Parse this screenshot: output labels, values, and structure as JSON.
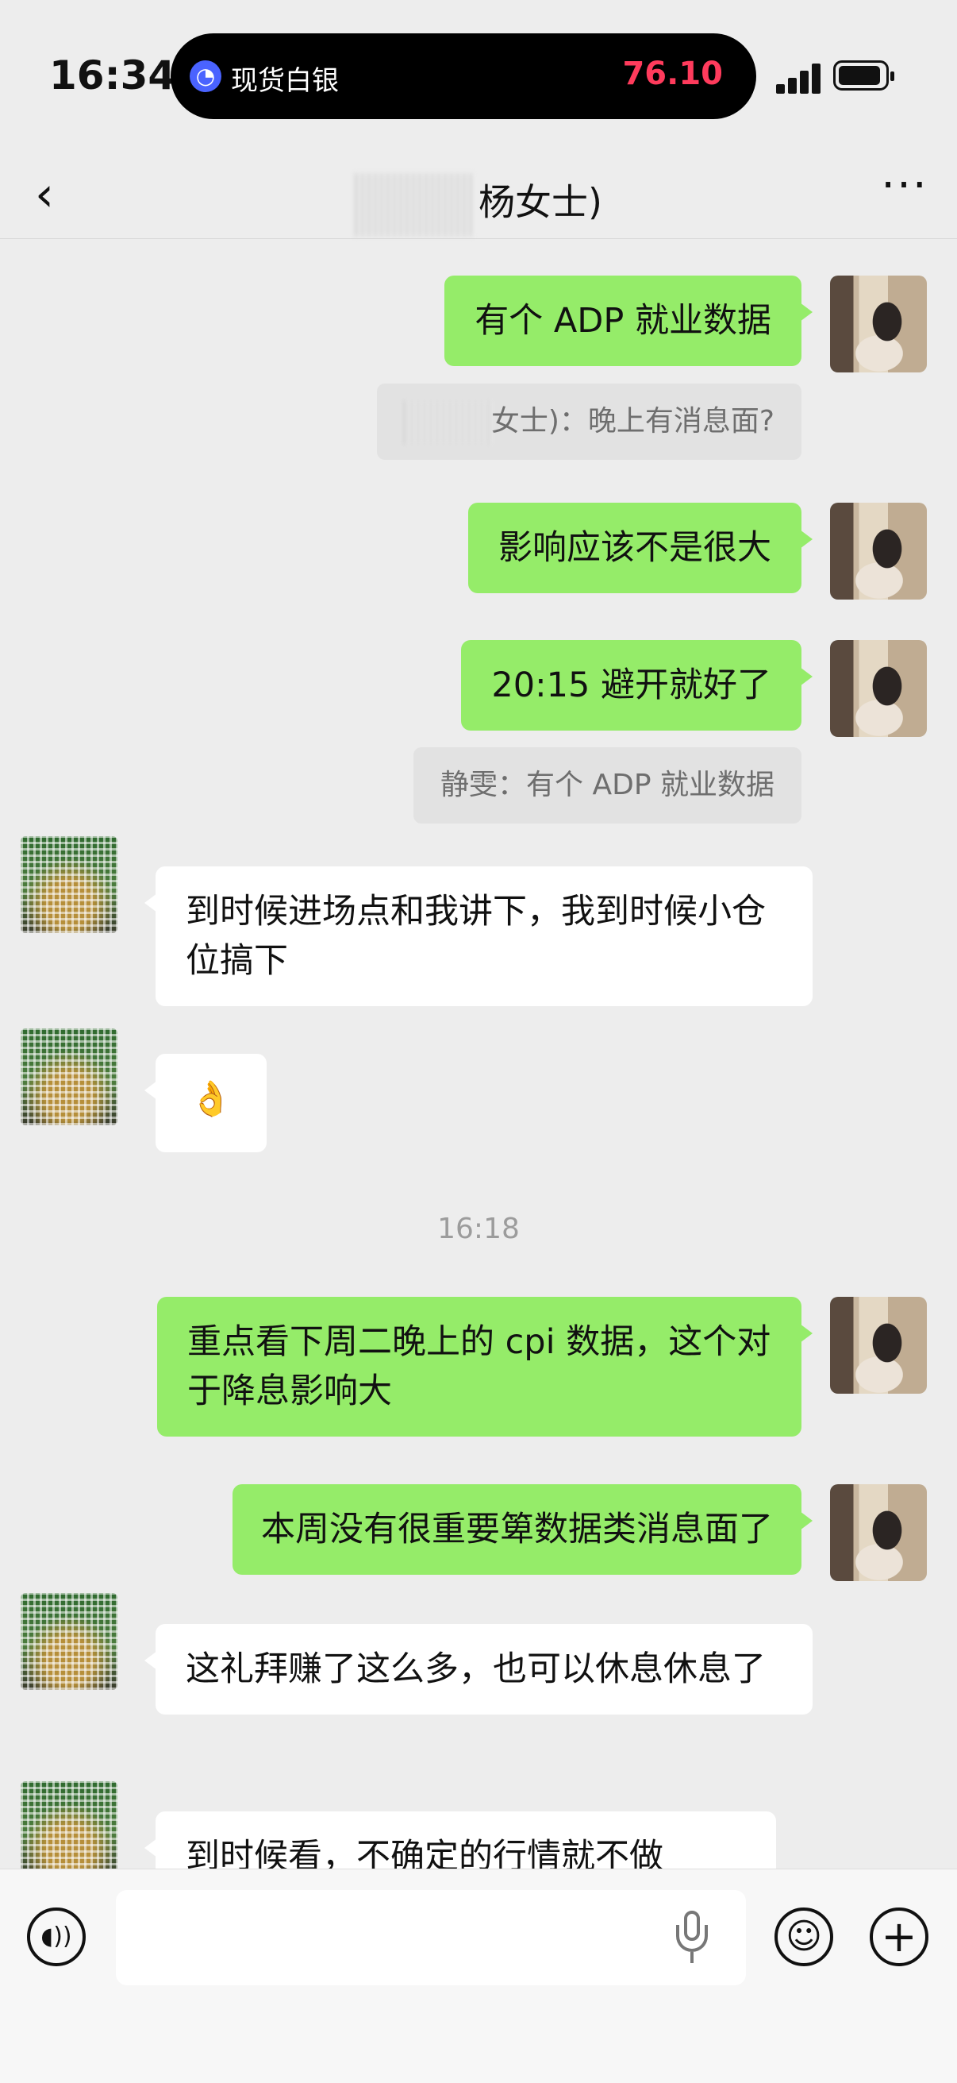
{
  "status_bar": {
    "time": "16:34",
    "live_activity_app": "现货白银",
    "live_activity_price": "76.10"
  },
  "header": {
    "title": "杨女士)",
    "back_icon": "chevron-left-icon",
    "more_icon": "more-dots-icon"
  },
  "messages": [
    {
      "side": "me",
      "text": "有个 ADP 就业数据"
    },
    {
      "type": "quote",
      "text": "女士)：晚上有消息面?"
    },
    {
      "side": "me",
      "text": "影响应该不是很大"
    },
    {
      "side": "me",
      "text": "20:15 避开就好了"
    },
    {
      "type": "quote",
      "text": "静雯：有个 ADP 就业数据"
    },
    {
      "side": "other",
      "text": "到时候进场点和我讲下，我到时候小仓位搞下"
    },
    {
      "side": "other",
      "text": "👌"
    },
    {
      "type": "timestamp",
      "text": "16:18"
    },
    {
      "side": "me",
      "text": "重点看下周二晚上的 cpi 数据，这个对于降息影响大"
    },
    {
      "side": "me",
      "text": "本周没有很重要箄数据类消息面了"
    },
    {
      "side": "other",
      "text": "这礼拜赚了这么多，也可以休息休息了"
    },
    {
      "side": "other",
      "text": "到时候看，不确定的行情就不做"
    }
  ],
  "input_bar": {
    "voice_icon": "voice-toggle-icon",
    "mic_icon": "microphone-icon",
    "emoji_icon": "emoji-icon",
    "plus_icon": "plus-icon",
    "value": ""
  },
  "colors": {
    "my_bubble": "#95ec69",
    "other_bubble": "#ffffff",
    "background": "#ededed",
    "price_red": "#ff3b5c"
  }
}
